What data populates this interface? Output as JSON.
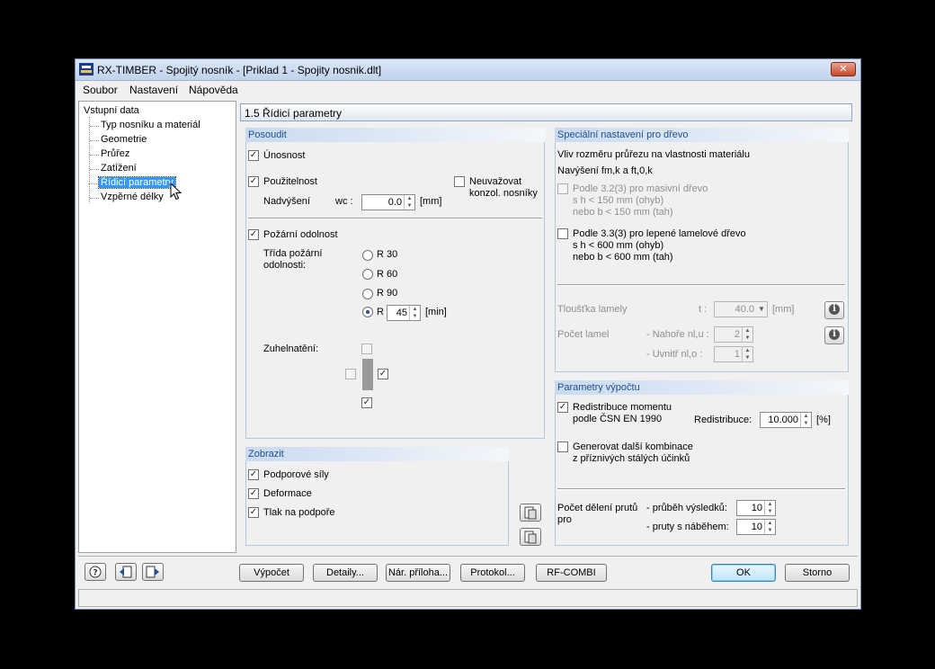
{
  "window": {
    "title": "RX-TIMBER - Spojitý nosník - [Priklad 1 - Spojity nosnik.dlt]",
    "close_glyph": "✕"
  },
  "menu": [
    "Soubor",
    "Nastavení",
    "Nápověda"
  ],
  "tree": {
    "root": "Vstupní data",
    "items": [
      "Typ nosníku a materiál",
      "Geometrie",
      "Průřez",
      "Zatížení",
      "Řídicí parametry",
      "Vzpěrné délky"
    ],
    "selected_index": 4
  },
  "section_title": "1.5 Řídicí parametry",
  "posoudit": {
    "title": "Posoudit",
    "unosnost": "Únosnost",
    "pouzitelnost": "Použitelnost",
    "neuvazovat": "Neuvažovat",
    "konzol": "konzol. nosníky",
    "nadvyseni_label": "Nadvýšení",
    "wc_label": "wc :",
    "wc_value": "0.0",
    "wc_unit": "[mm]",
    "pozarni": "Požární odolnost",
    "trida_label_1": "Třída požární",
    "trida_label_2": "odolnosti:",
    "radios": [
      "R 30",
      "R 60",
      "R 90",
      "R"
    ],
    "r_selected_index": 3,
    "r_value": "45",
    "r_unit": "[min]",
    "zuhelnateni": "Zuhelnatění:"
  },
  "zobrazit": {
    "title": "Zobrazit",
    "items": [
      "Podporové síly",
      "Deformace",
      "Tlak na podpoře"
    ]
  },
  "special": {
    "title": "Speciální nastavení pro dřevo",
    "vliv": "Vliv rozměru průřezu na vlastnosti materiálu",
    "navyseni": "Navýšení fm,k a ft,0,k",
    "opt1": [
      "Podle 3.2(3) pro masivní dřevo",
      "s h < 150 mm (ohyb)",
      "nebo b < 150 mm (tah)"
    ],
    "opt2": [
      "Podle 3.3(3) pro lepené lamelové dřevo",
      "s h < 600 mm (ohyb)",
      "nebo b < 600 mm (tah)"
    ],
    "tloustka_label": "Tloušťka lamely",
    "t_label": "t :",
    "t_value": "40.0",
    "t_unit": "[mm]",
    "pocet_label": "Počet lamel",
    "nahore_label": "- Nahoře nl,u :",
    "nahore_value": "2",
    "uvnitr_label": "- Uvnitř nl,o :",
    "uvnitr_value": "1"
  },
  "params": {
    "title": "Parametry výpočtu",
    "redistribuce_1": "Redistribuce momentu",
    "redistribuce_2": "podle ČSN EN 1990",
    "redistribuce_label": "Redistribuce:",
    "redistribuce_value": "10.000",
    "redistribuce_unit": "[%]",
    "generovat_1": "Generovat další kombinace",
    "generovat_2": "z příznivých stálých účinků",
    "pocet_deleni_1": "Počet dělení prutů",
    "pocet_deleni_2": "pro",
    "prubeh_label": "- průběh výsledků:",
    "prubeh_value": "10",
    "pruty_label": "- pruty s náběhem:",
    "pruty_value": "10"
  },
  "buttons": {
    "vypocet": "Výpočet",
    "detaily": "Detaily...",
    "nar_priloha": "Nár. příloha...",
    "protokol": "Protokol...",
    "rf_combi": "RF-COMBI",
    "ok": "OK",
    "storno": "Storno"
  },
  "icons": {
    "help": "help-icon",
    "prev": "prev-icon",
    "next": "next-icon",
    "info": "info-icon"
  }
}
